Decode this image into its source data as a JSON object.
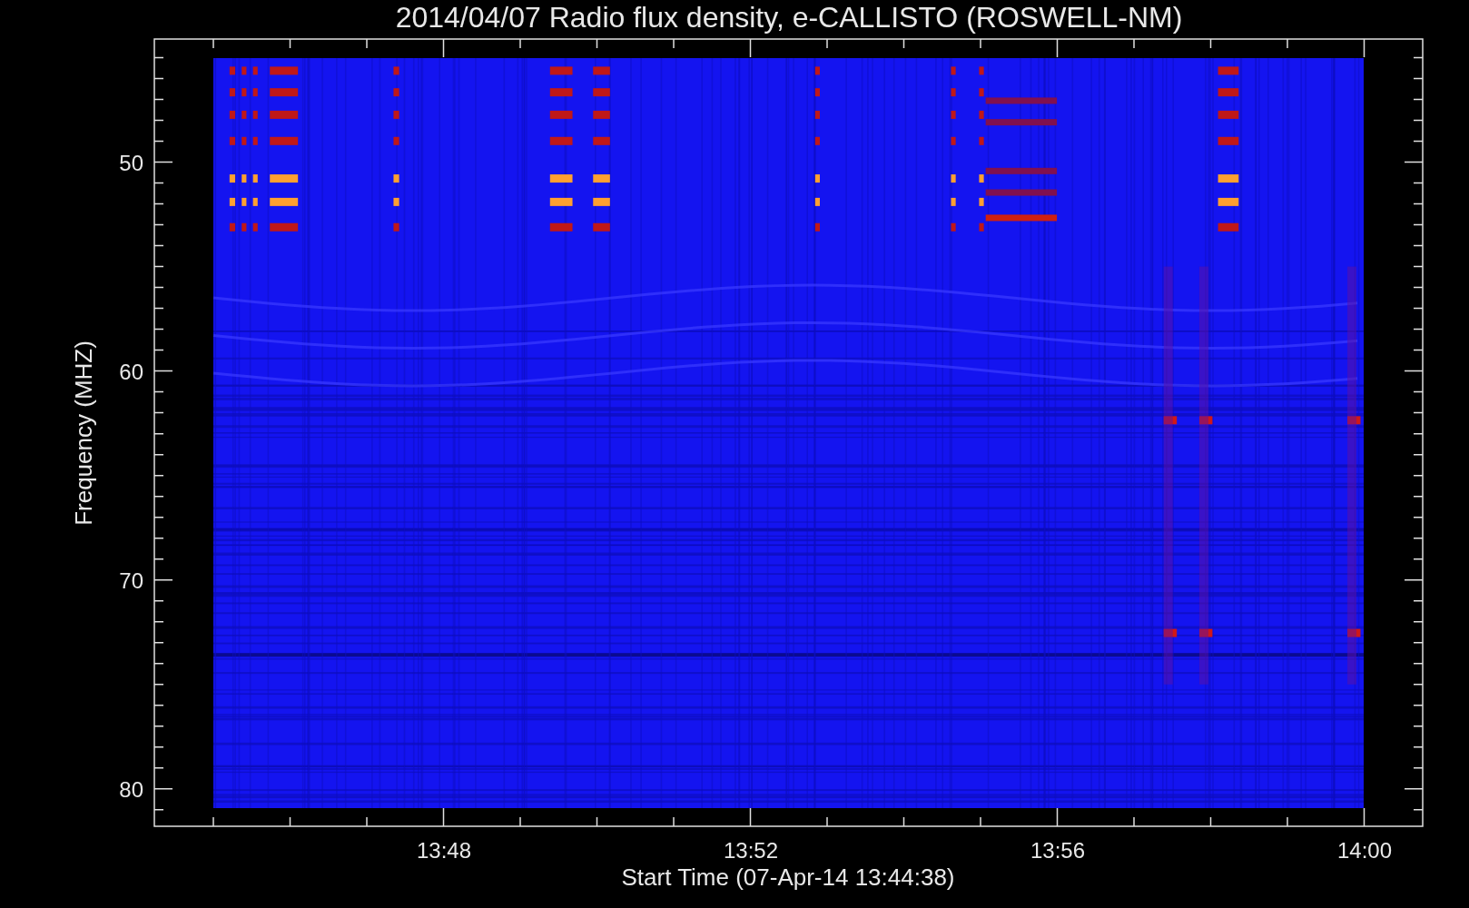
{
  "title": "2014/04/07  Radio flux density, e-CALLISTO (ROSWELL-NM)",
  "y_axis": {
    "label": "Frequency (MHZ)",
    "ticks": [
      "50",
      "60",
      "70",
      "80"
    ]
  },
  "x_axis": {
    "label": "Start Time (07-Apr-14 13:44:38)",
    "ticks": [
      "13:48",
      "13:52",
      "13:56",
      "14:00"
    ]
  }
}
